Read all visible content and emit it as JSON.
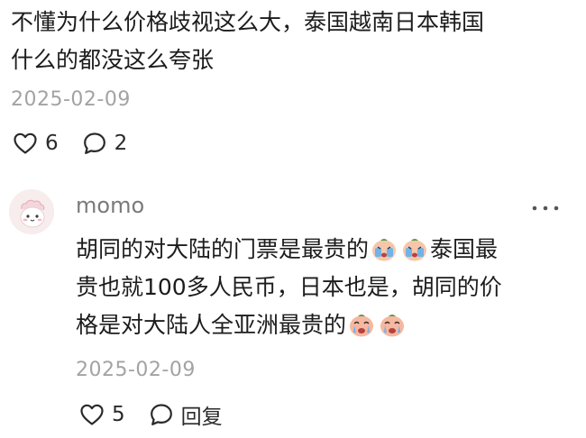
{
  "post": {
    "text_line1": "不懂为什么价格歧视这么大，泰国越南日本韩国",
    "text_line2": "什么的都没这么夸张",
    "date": "2025-02-09",
    "likes": "6",
    "comments": "2"
  },
  "reply": {
    "username": "momo",
    "line1_a": "胡同的对大陆的门票是最贵的",
    "line1_b": "泰国最",
    "line2": "贵也就100多人民币，日本也是，胡同的价",
    "line3_a": "格是对大陆人全亚洲最贵的",
    "date": "2025-02-09",
    "likes": "5",
    "reply_label": "回复"
  },
  "icons": {
    "like": "heart-outline-icon",
    "comment": "speech-bubble-icon",
    "more": "more-dots-icon",
    "emoji_crying": "crying-emoji-icon",
    "emoji_sobbing": "sobbing-emoji-icon"
  },
  "colors": {
    "text": "#1c1c1c",
    "meta": "#a3a3a3",
    "username": "#7a7a7a",
    "avatar_bg": "#f6eeee"
  }
}
